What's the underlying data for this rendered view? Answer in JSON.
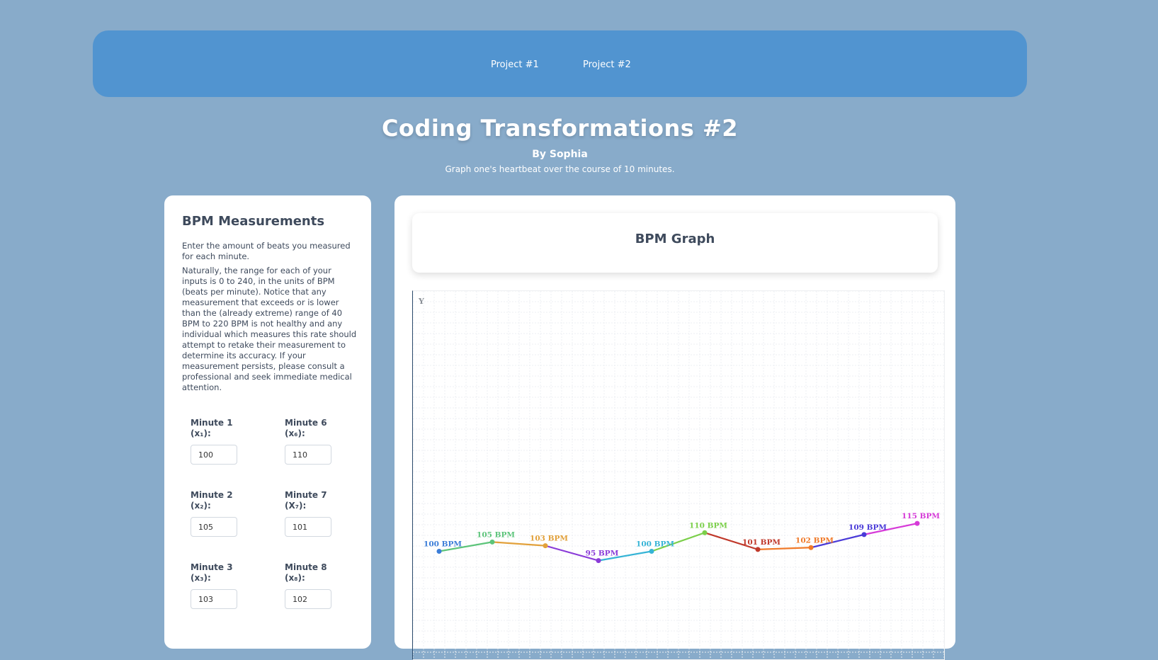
{
  "nav": {
    "links": [
      "Project #1",
      "Project #2"
    ]
  },
  "header": {
    "title": "Coding Transformations #2",
    "byline": "By Sophia",
    "subtitle": "Graph one's heartbeat over the course of 10 minutes."
  },
  "panel": {
    "heading": "BPM Measurements",
    "intro": "Enter the amount of beats you measured for each minute.",
    "body": "Naturally, the range for each of your inputs is 0 to 240, in the units of BPM (beats per minute). Notice that any measurement that exceeds or is lower than the (already extreme) range of 40 BPM to 220 BPM is not healthy and any individual which measures this rate should attempt to retake their measurement to determine its accuracy. If your measurement persists, please consult a professional and seek immediate medical attention.",
    "fields": [
      {
        "label": "Minute 1",
        "sub": "(x₁):",
        "value": "100"
      },
      {
        "label": "Minute 6",
        "sub": "(x₆):",
        "value": "110"
      },
      {
        "label": "Minute 2",
        "sub": "(x₂):",
        "value": "105"
      },
      {
        "label": "Minute 7",
        "sub": "(X₇):",
        "value": "101"
      },
      {
        "label": "Minute 3",
        "sub": "(x₃):",
        "value": "103"
      },
      {
        "label": "Minute 8",
        "sub": "(x₈):",
        "value": "102"
      }
    ]
  },
  "graph": {
    "title": "BPM Graph",
    "y_axis_label": "Y"
  },
  "chart_data": {
    "type": "line",
    "x": [
      1,
      2,
      3,
      4,
      5,
      6,
      7,
      8,
      9,
      10
    ],
    "values": [
      100,
      105,
      103,
      95,
      100,
      110,
      101,
      102,
      109,
      115
    ],
    "labels": [
      "100 BPM",
      "105 BPM",
      "103 BPM",
      "95 BPM",
      "100 BPM",
      "110 BPM",
      "101 BPM",
      "102 BPM",
      "109 BPM",
      "115 BPM"
    ],
    "colors": [
      "#3b7dd8",
      "#5cc47a",
      "#e2a13b",
      "#8a3bd8",
      "#36b4d6",
      "#7bcf4a",
      "#c0392b",
      "#f07a2a",
      "#4a3bd8",
      "#d63bd8"
    ],
    "ylim": [
      0,
      240
    ],
    "grid": true
  }
}
